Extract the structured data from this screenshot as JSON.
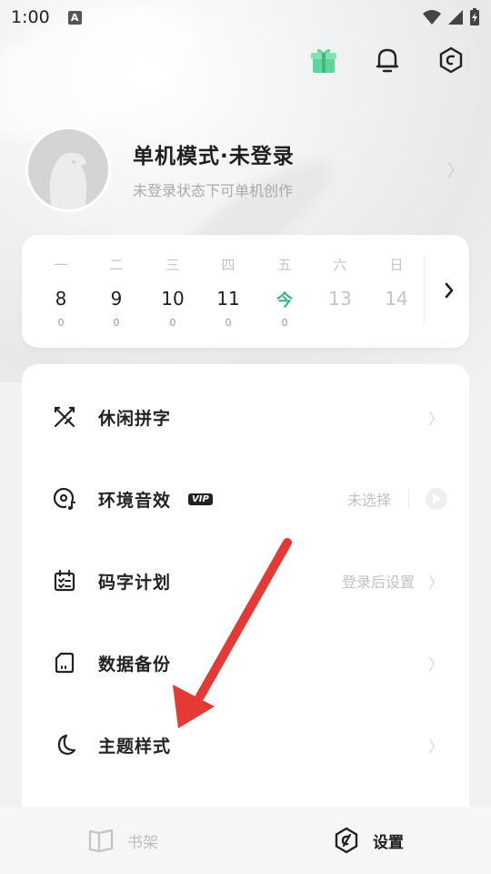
{
  "status_bar": {
    "time": "1:00",
    "notification_badge": "A"
  },
  "top_icons": [
    "gift-icon",
    "bell-icon",
    "settings-hex-icon"
  ],
  "profile": {
    "name": "单机模式·未登录",
    "subtitle": "未登录状态下可单机创作"
  },
  "calendar": {
    "days": [
      {
        "weekday": "一",
        "date": "8",
        "count": "0",
        "state": "past"
      },
      {
        "weekday": "二",
        "date": "9",
        "count": "0",
        "state": "past"
      },
      {
        "weekday": "三",
        "date": "10",
        "count": "0",
        "state": "past"
      },
      {
        "weekday": "四",
        "date": "11",
        "count": "0",
        "state": "past"
      },
      {
        "weekday": "五",
        "date": "今",
        "count": "0",
        "state": "today"
      },
      {
        "weekday": "六",
        "date": "13",
        "count": "",
        "state": "future"
      },
      {
        "weekday": "日",
        "date": "14",
        "count": "",
        "state": "future"
      }
    ]
  },
  "menu": {
    "items": [
      {
        "label": "休闲拼字",
        "icon": "swords-icon"
      },
      {
        "label": "环境音效",
        "icon": "disc-music-icon",
        "badge": "VIP",
        "value": "未选择"
      },
      {
        "label": "码字计划",
        "icon": "calendar-check-icon",
        "value": "登录后设置"
      },
      {
        "label": "数据备份",
        "icon": "sd-card-icon"
      },
      {
        "label": "主题样式",
        "icon": "moon-icon"
      }
    ]
  },
  "bottom_nav": {
    "tabs": [
      {
        "label": "书架",
        "icon": "book-icon",
        "active": false
      },
      {
        "label": "设置",
        "icon": "settings-tab-icon",
        "active": true
      }
    ]
  },
  "colors": {
    "accent_today": "#35b681",
    "gift_green": "#5cd69a",
    "arrow_red": "#e53935"
  }
}
